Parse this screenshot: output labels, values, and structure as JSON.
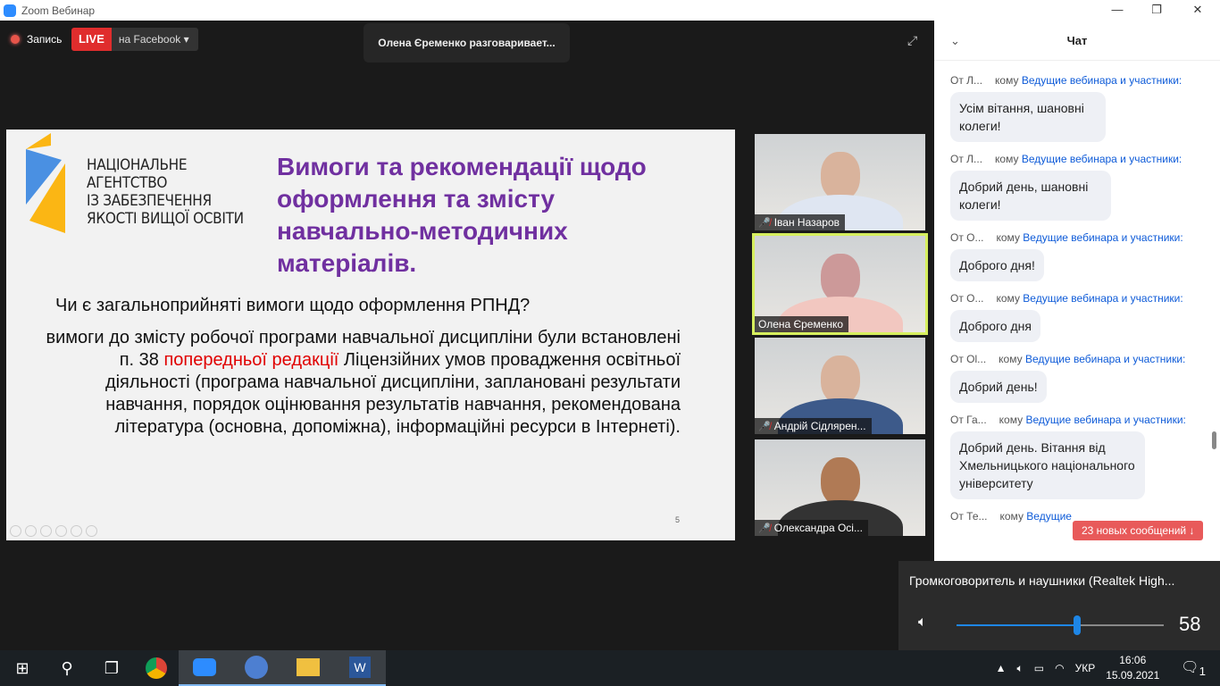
{
  "window": {
    "title": "Zoom Вебинар",
    "controls": [
      "—",
      "❐",
      "✕"
    ]
  },
  "toolbar": {
    "record_label": "Запись",
    "live_label": "LIVE",
    "live_target": "на Facebook",
    "speaker_notice": "Олена Єременко  разговаривает..."
  },
  "slide": {
    "org_lines": [
      "НАЦІОНАЛЬНЕ",
      "АГЕНТСТВО",
      "ІЗ ЗАБЕЗПЕЧЕННЯ",
      "ЯКОСТІ ВИЩОЇ ОСВІТИ"
    ],
    "title": "Вимоги та рекомендації щодо оформлення та змісту навчально-методичних матеріалів.",
    "question": "Чи є загальноприйняті вимоги щодо оформлення РПНД?",
    "body_before": "вимоги до змісту робочої програми навчальної дисципліни були встановлені п. 38 ",
    "body_highlight": "попередньої редакції",
    "body_after": " Ліцензійних умов провадження освітньої діяльності (програма навчальної дисципліни, заплановані результати навчання, порядок оцінювання результатів навчання, рекомендована література (основна, допоміжна), інформаційні ресурси в Інтернеті).",
    "page_number": "5",
    "title_color": "#7030a0"
  },
  "participants": [
    {
      "name": "Іван Назаров"
    },
    {
      "name": "Олена Єременко"
    },
    {
      "name": "Андрій Сідлярен..."
    },
    {
      "name": "Олександра Осі..."
    }
  ],
  "chat": {
    "title": "Чат",
    "messages": [
      {
        "from": "От Л...",
        "to_label": "кому",
        "to": "Ведущие вебинара и участники:",
        "text": "Усім вітання, шановні колеги!"
      },
      {
        "from": "От Л...",
        "to_label": "кому",
        "to": "Ведущие вебинара и участники:",
        "text": "Добрий день, шановні колеги!"
      },
      {
        "from": "От О...",
        "to_label": "кому",
        "to": "Ведущие вебинара и участники:",
        "text": "Доброго дня!"
      },
      {
        "from": "От О...",
        "to_label": "кому",
        "to": "Ведущие вебинара и участники:",
        "text": "Доброго дня"
      },
      {
        "from": "От Ol...",
        "to_label": "кому",
        "to": "Ведущие вебинара и участники:",
        "text": "Добрий день!"
      },
      {
        "from": "От Га...",
        "to_label": "кому",
        "to": "Ведущие вебинара и участники:",
        "text": "Добрий день. Вітання від Хмельницького національного університету"
      },
      {
        "from": "От Те...",
        "to_label": "кому",
        "to": "Ведущие",
        "text": ""
      }
    ],
    "new_messages": "23 новых сообщений ↓"
  },
  "volume": {
    "device": "Громкоговоритель и наушники (Realtek High...",
    "value": 58,
    "value_label": "58"
  },
  "taskbar": {
    "lang": "УКР",
    "time": "16:06",
    "date": "15.09.2021",
    "notifications": "1"
  }
}
